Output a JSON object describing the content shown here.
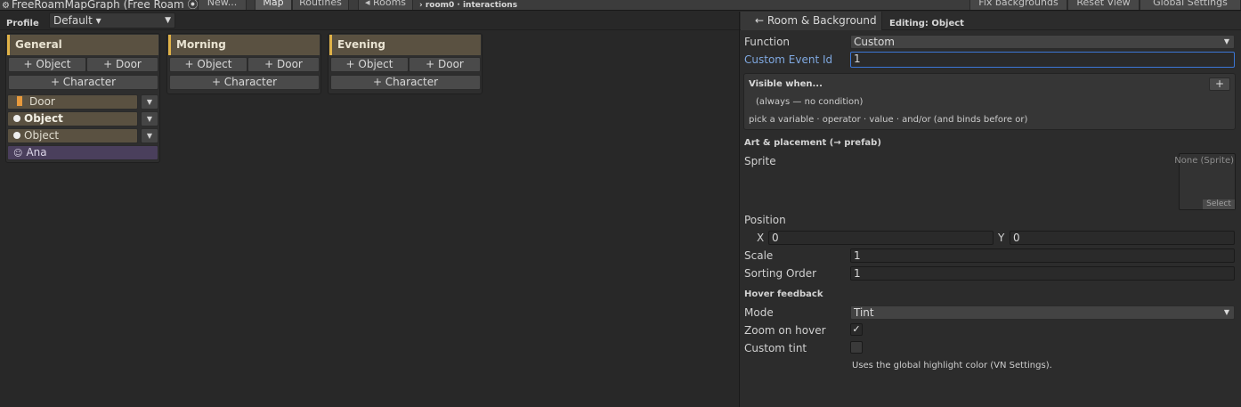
{
  "toolbar": {
    "title": "FreeRoamMapGraph (Free Roam",
    "new_label": "New...",
    "map_label": "Map",
    "routines_label": "Routines",
    "rooms_label": "◂ Rooms",
    "breadcrumb": "› room0 · interactions",
    "fix_backgrounds_label": "Fix backgrounds",
    "reset_view_label": "Reset View",
    "global_settings_label": "Global Settings"
  },
  "profile": {
    "label": "Profile",
    "value": "Default ▾"
  },
  "columns": [
    {
      "title": "General",
      "add_object": "+ Object",
      "add_door": "+ Door",
      "add_character": "+ Character"
    },
    {
      "title": "Morning",
      "add_object": "+ Object",
      "add_door": "+ Door",
      "add_character": "+ Character"
    },
    {
      "title": "Evening",
      "add_object": "+ Object",
      "add_door": "+ Door",
      "add_character": "+ Character"
    }
  ],
  "general_items": [
    {
      "label": "Door",
      "kind": "door"
    },
    {
      "label": "Object",
      "kind": "object"
    },
    {
      "label": "Object",
      "kind": "object"
    },
    {
      "label": "Ana",
      "kind": "character"
    }
  ],
  "inspector": {
    "back_label": "← Room & Background",
    "editing_label": "Editing: Object",
    "function_label": "Function",
    "function_value": "Custom",
    "custom_event_label": "Custom Event Id",
    "custom_event_value": "1",
    "visible_title": "Visible when...",
    "visible_add": "+",
    "visible_condition": "(always — no condition)",
    "visible_help": "pick a variable · operator · value · and/or  (and binds before or)",
    "art_section": "Art & placement (→ prefab)",
    "sprite_label": "Sprite",
    "sprite_none": "None (Sprite)",
    "sprite_select": "Select",
    "position_label": "Position",
    "x_label": "X",
    "x_value": "0",
    "y_label": "Y",
    "y_value": "0",
    "scale_label": "Scale",
    "scale_value": "1",
    "sorting_label": "Sorting Order",
    "sorting_value": "1",
    "hover_section": "Hover feedback",
    "mode_label": "Mode",
    "mode_value": "Tint",
    "zoom_label": "Zoom on hover",
    "zoom_checked": true,
    "tint_label": "Custom tint",
    "tint_checked": false,
    "tint_hint": "Uses the global highlight color (VN Settings)."
  },
  "colors": {
    "accent_yellow": "#e0b248",
    "header_brown": "#5a5141",
    "character_purple": "#4a3f5c",
    "focus_blue": "#3b76d6",
    "link_blue": "#7fa8e0"
  }
}
